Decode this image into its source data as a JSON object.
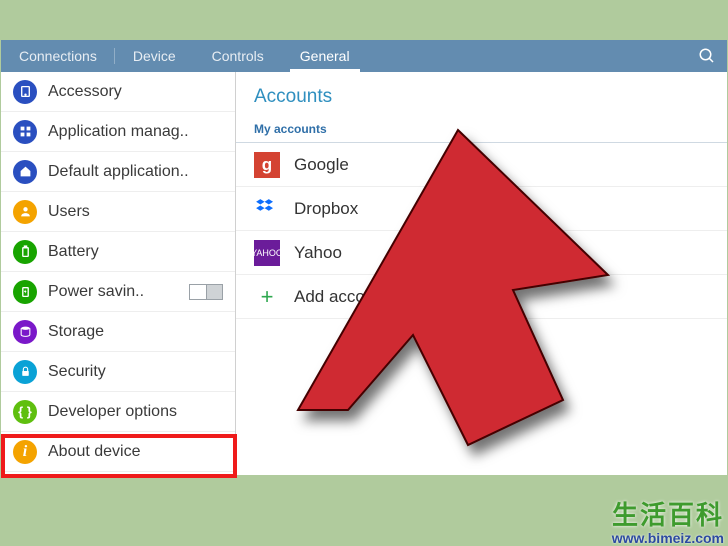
{
  "tabs": {
    "connections": "Connections",
    "device": "Device",
    "controls": "Controls",
    "general": "General"
  },
  "sidebar": {
    "items": [
      {
        "label": "Accessory",
        "icon": "tablet",
        "color": "#2a4fc0"
      },
      {
        "label": "Application manag..",
        "icon": "grid",
        "color": "#2a4fc0"
      },
      {
        "label": "Default application..",
        "icon": "home",
        "color": "#2a4fc0"
      },
      {
        "label": "Users",
        "icon": "user",
        "color": "#f4a300"
      },
      {
        "label": "Battery",
        "icon": "battery",
        "color": "#18a400"
      },
      {
        "label": "Power savin..",
        "icon": "power",
        "color": "#18a400",
        "toggle": true
      },
      {
        "label": "Storage",
        "icon": "db",
        "color": "#7a18c9"
      },
      {
        "label": "Security",
        "icon": "lock",
        "color": "#0aa2d6"
      },
      {
        "label": "Developer options",
        "icon": "braces",
        "color": "#5fbf0f"
      },
      {
        "label": "About device",
        "icon": "info",
        "color": "#f4a300"
      }
    ]
  },
  "main": {
    "title": "Accounts",
    "subhead": "My accounts",
    "accounts": [
      {
        "label": "Google",
        "kind": "google"
      },
      {
        "label": "Dropbox",
        "kind": "dropbox"
      },
      {
        "label": "Yahoo",
        "kind": "yahoo"
      },
      {
        "label": "Add account",
        "kind": "add"
      }
    ]
  },
  "watermark": {
    "line1": "生活百科",
    "line2": "www.bimeiz.com"
  }
}
